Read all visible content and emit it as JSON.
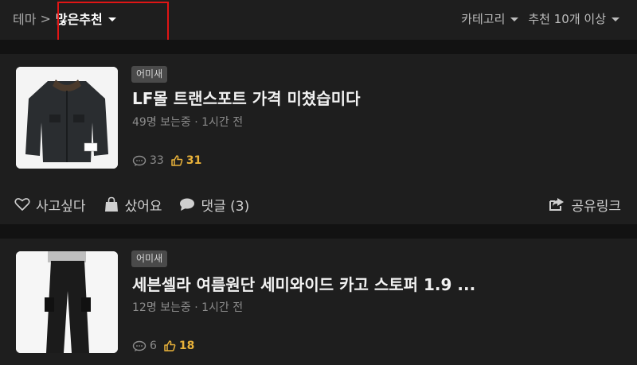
{
  "header": {
    "breadcrumb_root": "테마",
    "breadcrumb_sep": ">",
    "current_theme": "많은추천",
    "category_filter": "카테고리",
    "recommend_filter": "추천 10개 이상"
  },
  "posts": [
    {
      "tag": "어미새",
      "title": "LF몰 트랜스포트 가격 미쳤습미다",
      "meta": "49명 보는중 · 1시간 전",
      "comments": "33",
      "likes": "31"
    },
    {
      "tag": "어미새",
      "title": "세븐셀라 여름원단 세미와이드 카고 스토퍼 1.9 ...",
      "meta": "12명 보는중 · 1시간 전",
      "comments": "6",
      "likes": "18"
    }
  ],
  "actions": {
    "want": "사고싶다",
    "bought": "샀어요",
    "comments": "댓글 (3)",
    "share": "공유링크"
  },
  "colors": {
    "accent_like": "#e9b23a",
    "highlight": "#e01515",
    "background": "#1e1e1e"
  },
  "icons": [
    "caret-down-icon",
    "comment-icon",
    "thumbs-up-icon",
    "heart-icon",
    "shopping-bag-icon",
    "speech-bubble-icon",
    "share-icon"
  ]
}
